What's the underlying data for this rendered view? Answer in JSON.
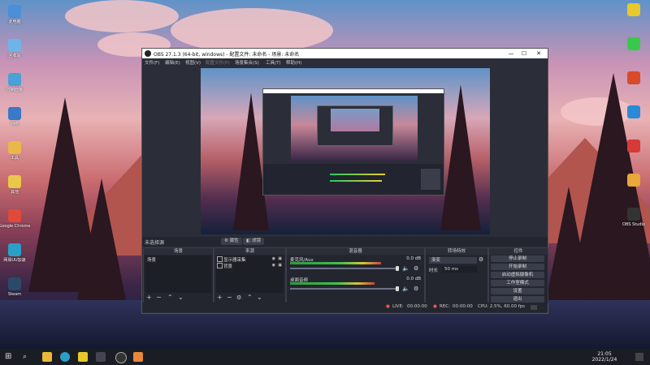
{
  "window": {
    "title": "OBS 27.1.3 (64-bit, windows) - 配置文件: 未命名 - 场景: 未命名",
    "minimize": "—",
    "maximize": "☐",
    "close": "✕"
  },
  "menu": [
    "文件(F)",
    "编辑(E)",
    "视图(V)",
    "配置文件(P)",
    "场景集合(S)",
    "工具(T)",
    "帮助(H)"
  ],
  "status_line": {
    "selection": "未选择源",
    "properties_label": "属性",
    "filters_label": "滤镜"
  },
  "docks": {
    "scenes": {
      "title": "场景",
      "items": [
        "场景"
      ]
    },
    "sources": {
      "title": "来源",
      "items": [
        "显示器采集",
        "背景"
      ]
    },
    "mixer": {
      "title": "混音器",
      "channels": [
        {
          "name": "麦克风/Aux",
          "db": "0.0 dB",
          "level": 0.7
        },
        {
          "name": "桌面音频",
          "db": "0.0 dB",
          "level": 0.65
        }
      ]
    },
    "transitions": {
      "title": "转场特效",
      "transition": "渐变",
      "duration_label": "时长",
      "duration": "50 ms"
    },
    "controls": {
      "title": "控件",
      "buttons": [
        "停止录制",
        "开始录制",
        "启动虚拟摄像机",
        "工作室模式",
        "设置",
        "退出"
      ]
    }
  },
  "bottom_status": {
    "live_label": "LIVE:",
    "live_time": "00:00:00",
    "rec_label": "REC:",
    "rec_time": "00:00:00",
    "cpu": "CPU: 2.5%, 60.00 fps"
  },
  "desktop_icons_left": [
    {
      "label": "此电脑",
      "color": "#4a8fd8"
    },
    {
      "label": "回收站",
      "color": "#6fb4e8"
    },
    {
      "label": "控制面板",
      "color": "#4aa0d8"
    },
    {
      "label": "网络",
      "color": "#3a78c8"
    },
    {
      "label": "工具",
      "color": "#e9b84a"
    },
    {
      "label": "其他",
      "color": "#e9c84a"
    },
    {
      "label": "Google Chrome",
      "color": "#e04a3a"
    },
    {
      "label": "网易UU加速",
      "color": "#2aa0c8"
    },
    {
      "label": "Steam",
      "color": "#2a4a6a"
    }
  ],
  "desktop_icons_right": [
    {
      "label": "",
      "color": "#e8c82a"
    },
    {
      "label": "",
      "color": "#3ac84a"
    },
    {
      "label": "",
      "color": "#d84a2a"
    },
    {
      "label": "",
      "color": "#2a8ad8"
    },
    {
      "label": "",
      "color": "#d83a3a"
    },
    {
      "label": "",
      "color": "#e8a83a"
    },
    {
      "label": "OBS Studio",
      "color": "#333333"
    }
  ],
  "taskbar": {
    "time": "21:05",
    "date": "2022/1/24"
  }
}
